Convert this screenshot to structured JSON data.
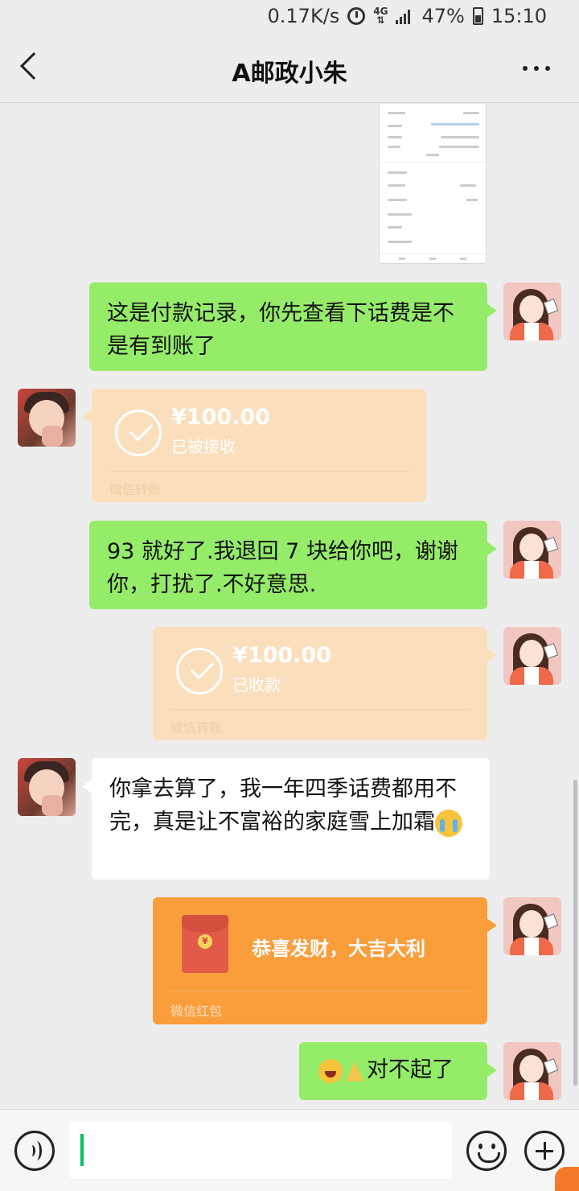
{
  "status_bar": {
    "speed": "0.17K/s",
    "network": "4G",
    "battery": "47%",
    "time": "15:10"
  },
  "header": {
    "title": "A邮政小朱"
  },
  "messages": [
    {
      "type": "image",
      "sender": "me"
    },
    {
      "type": "text",
      "sender": "me",
      "text": "这是付款记录，你先查看下话费是不是有到账了"
    },
    {
      "type": "transfer",
      "sender": "other",
      "amount": "¥100.00",
      "status": "已被接收",
      "footer": "微信转账"
    },
    {
      "type": "text",
      "sender": "me",
      "text": "93 就好了.我退回 7 块给你吧，谢谢你，打扰了.不好意思."
    },
    {
      "type": "transfer",
      "sender": "me",
      "amount": "¥100.00",
      "status": "已收款",
      "footer": "微信转账"
    },
    {
      "type": "text",
      "sender": "other",
      "text": "你拿去算了，我一年四季话费都用不完，真是让不富裕的家庭雪上加霜",
      "emoji": "loudly-crying-face"
    },
    {
      "type": "red_packet",
      "sender": "me",
      "title": "恭喜发财，大吉大利",
      "footer": "微信红包"
    },
    {
      "type": "text",
      "sender": "me",
      "text": "对不起了",
      "emojis": [
        "face-with-tears-of-joy",
        "folded-hands"
      ]
    }
  ],
  "input": {
    "value": "",
    "placeholder": ""
  },
  "colors": {
    "my_bubble": "#95ec69",
    "other_bubble": "#ffffff",
    "transfer": "#fbdfbc",
    "red_packet": "#fa9d3b",
    "background": "#ededed"
  }
}
